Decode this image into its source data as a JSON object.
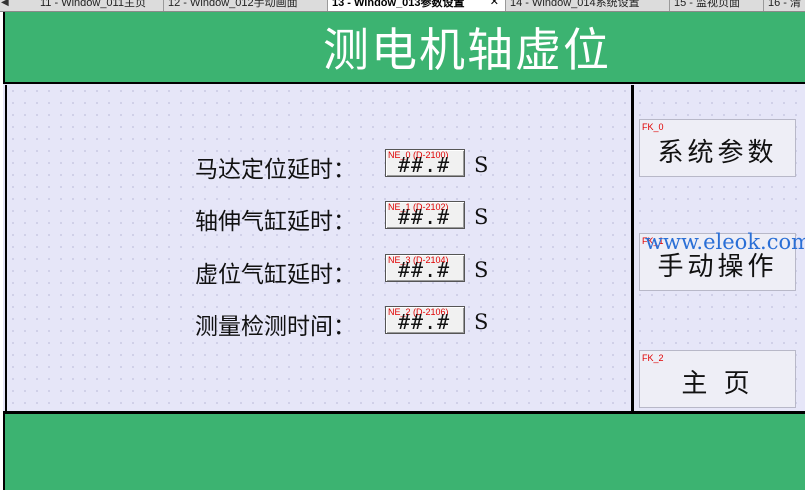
{
  "tabs": [
    {
      "label": "11 - Window_011主页",
      "active": false
    },
    {
      "label": "12 - Window_012手动画面",
      "active": false
    },
    {
      "label": "13 - Window_013参数设置",
      "active": true
    },
    {
      "label": "14 - Window_014系统设置",
      "active": false
    },
    {
      "label": "15 - 监视页面",
      "active": false
    },
    {
      "label": "16 - 清",
      "active": false
    }
  ],
  "tab_close": "✕",
  "tab_scroll_left": "◀",
  "page_title": "测电机轴虚位",
  "params": [
    {
      "label": "马达定位延时：",
      "tag": "NE_0 (D-2100)",
      "value": "##.#",
      "unit": "S"
    },
    {
      "label": "轴伸气缸延时：",
      "tag": "NE_1 (D-2102)",
      "value": "##.#",
      "unit": "S"
    },
    {
      "label": "虚位气缸延时：",
      "tag": "NE_3 (D-2104)",
      "value": "##.#",
      "unit": "S"
    },
    {
      "label": "测量检测时间：",
      "tag": "NE_2 (D-2106)",
      "value": "##.#",
      "unit": "S"
    }
  ],
  "side_buttons": [
    {
      "tag": "FK_0",
      "label": "系统参数"
    },
    {
      "tag": "FK_1",
      "label": "手动操作"
    },
    {
      "tag": "FK_2",
      "label": "主 页"
    }
  ],
  "watermark": "www.eleok.com",
  "colors": {
    "header_green": "#3cb371",
    "panel_bg": "#e6e6f8",
    "tag_red": "#e00000",
    "watermark_blue": "#2a6fd6"
  }
}
